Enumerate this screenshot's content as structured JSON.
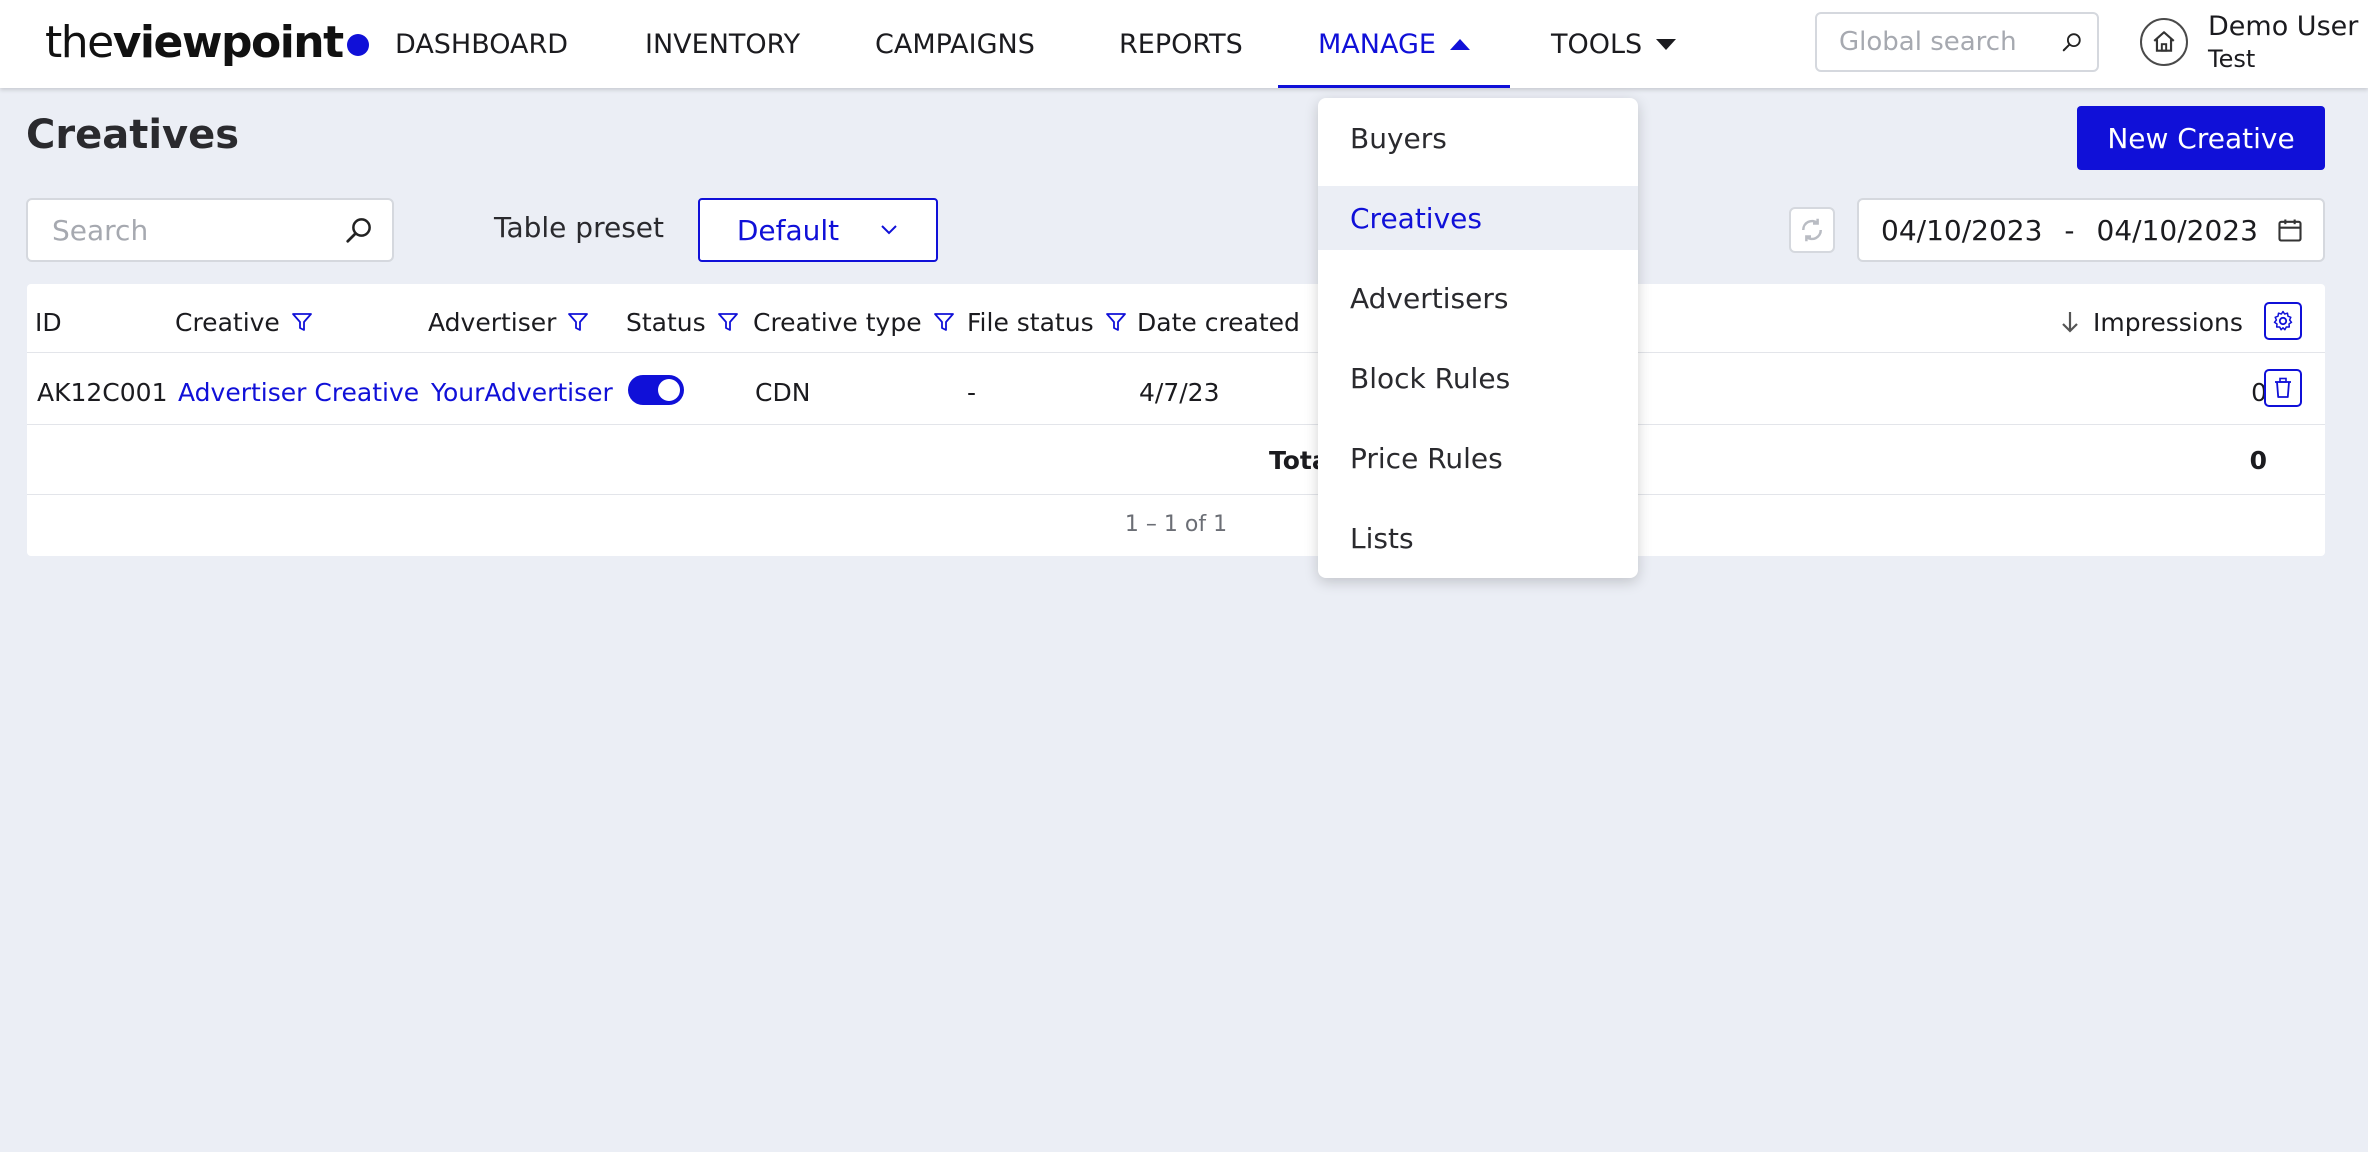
{
  "brand": {
    "light": "the",
    "bold": "viewpoint"
  },
  "nav": {
    "items": [
      {
        "label": "DASHBOARD"
      },
      {
        "label": "INVENTORY"
      },
      {
        "label": "CAMPAIGNS"
      },
      {
        "label": "REPORTS"
      },
      {
        "label": "MANAGE"
      },
      {
        "label": "TOOLS"
      }
    ],
    "active": "MANAGE"
  },
  "global_search": {
    "placeholder": "Global search",
    "icon": "search-icon"
  },
  "user": {
    "name": "Demo User",
    "role": "Test",
    "icon": "home-icon"
  },
  "page": {
    "title": "Creatives",
    "new_button": "New Creative"
  },
  "toolbar": {
    "search_placeholder": "Search",
    "preset_label": "Table preset",
    "preset_value": "Default",
    "date_from": "04/10/2023",
    "date_separator": "-",
    "date_to": "04/10/2023"
  },
  "table": {
    "columns": [
      "ID",
      "Creative",
      "Advertiser",
      "Status",
      "Creative type",
      "File status",
      "Date created",
      "Impressions"
    ],
    "sort": {
      "column": "Impressions",
      "direction": "descending"
    },
    "rows": [
      {
        "id": "AK12C001",
        "creative": "Advertiser Creative",
        "advertiser": "YourAdvertiser",
        "status_on": true,
        "creative_type": "CDN",
        "file_status": "-",
        "date_created": "4/7/23",
        "impressions": "0"
      }
    ],
    "total_label": "Total",
    "total_impressions": "0",
    "pagination": "1 – 1 of 1"
  },
  "manage_menu": {
    "items": [
      "Buyers",
      "Creatives",
      "Advertisers",
      "Block Rules",
      "Price Rules",
      "Lists"
    ],
    "selected": "Creatives"
  },
  "colors": {
    "accent": "#1010d8",
    "background": "#ebeef5",
    "surface": "#ffffff",
    "border": "#d5d8de"
  }
}
